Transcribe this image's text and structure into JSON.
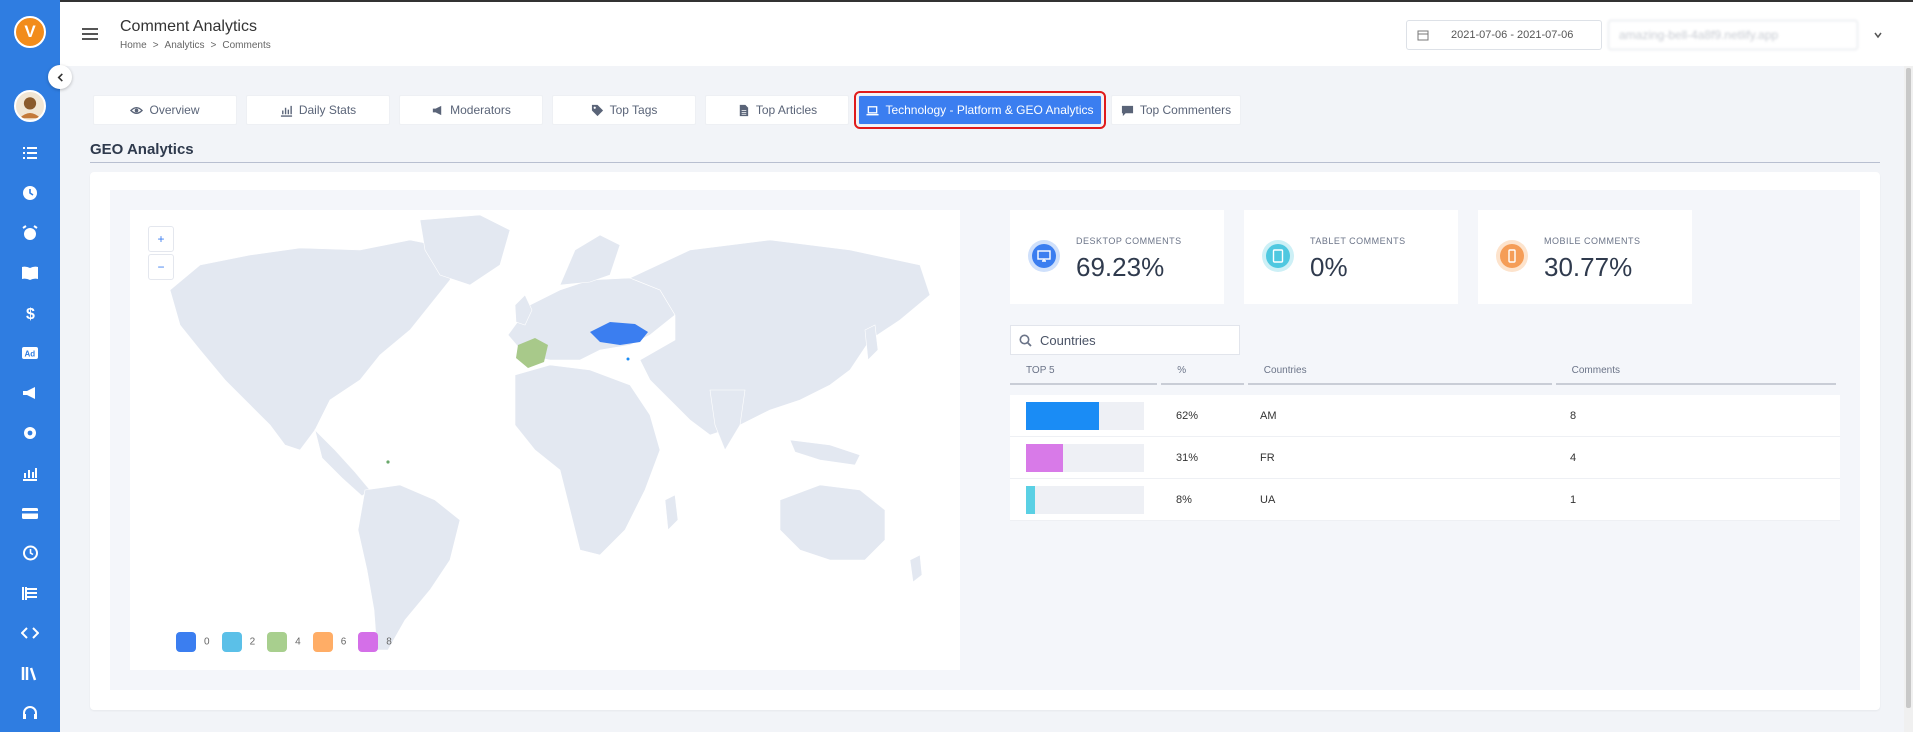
{
  "header": {
    "title": "Comment Analytics",
    "breadcrumb": [
      "Home",
      ">",
      "Analytics",
      ">",
      "Comments"
    ],
    "date_range": "2021-07-06 - 2021-07-06",
    "site_select": "amazing-bell-4a8f9.netlify.app"
  },
  "tabs": [
    {
      "label": "Overview",
      "icon": "eye-icon"
    },
    {
      "label": "Daily Stats",
      "icon": "chart-icon"
    },
    {
      "label": "Moderators",
      "icon": "megaphone-icon"
    },
    {
      "label": "Top Tags",
      "icon": "tags-icon"
    },
    {
      "label": "Top Articles",
      "icon": "file-icon"
    },
    {
      "label": "Technology - Platform & GEO Analytics",
      "icon": "laptop-icon",
      "active": true
    },
    {
      "label": "Top Commenters",
      "icon": "comment-icon"
    }
  ],
  "section": {
    "title": "GEO Analytics"
  },
  "map": {
    "zoom_in": "+",
    "zoom_out": "−",
    "legend": [
      "0",
      "2",
      "4",
      "6",
      "8"
    ],
    "legend_colors": [
      "#3b7ef0",
      "#5bc0e8",
      "#a8cf8e",
      "#ffad66",
      "#d46fe8"
    ],
    "land_color": "#e3e8f1",
    "highlight": {
      "FR": "#a8c98a",
      "UA": "#3b7ef0"
    }
  },
  "stats": [
    {
      "label": "DESKTOP COMMENTS",
      "value": "69.23%",
      "icon": "desktop-icon",
      "color": "#3b7ef0",
      "ring": "#cfe0fb"
    },
    {
      "label": "TABLET COMMENTS",
      "value": "0%",
      "icon": "tablet-icon",
      "color": "#4fc8e0",
      "ring": "#cdf0f6"
    },
    {
      "label": "MOBILE COMMENTS",
      "value": "30.77%",
      "icon": "mobile-icon",
      "color": "#f59d57",
      "ring": "#fde3cc"
    }
  ],
  "countries_search": {
    "placeholder": "Countries"
  },
  "table": {
    "headers": [
      "TOP 5",
      "%",
      "Countries",
      "Comments"
    ],
    "rows": [
      {
        "pct": "62%",
        "country": "AM",
        "comments": "8",
        "fill": 0.62,
        "color": "#1a8cf5"
      },
      {
        "pct": "31%",
        "country": "FR",
        "comments": "4",
        "fill": 0.31,
        "color": "#d87ae8"
      },
      {
        "pct": "8%",
        "country": "UA",
        "comments": "1",
        "fill": 0.08,
        "color": "#5ad0e4"
      }
    ]
  },
  "sidebar": {
    "logo": "V",
    "items": [
      "list-icon",
      "clock-icon",
      "alarm-icon",
      "book-icon",
      "dollar-icon",
      "ad-icon",
      "megaphone-icon",
      "gear-icon",
      "analytics-icon",
      "card-icon",
      "history-icon",
      "bars-icon",
      "code-icon",
      "library-icon",
      "headset-icon"
    ]
  }
}
